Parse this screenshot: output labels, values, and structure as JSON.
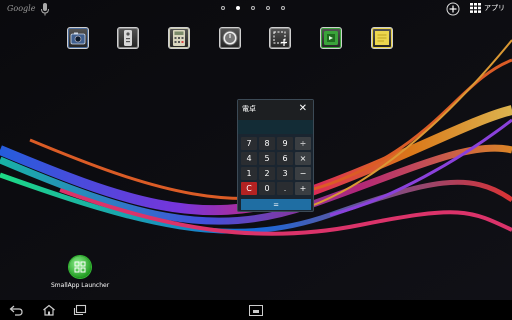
{
  "topbar": {
    "search_label": "Google",
    "pages": [
      false,
      true,
      false,
      false,
      false
    ],
    "apps_label": "アプリ"
  },
  "small_apps": [
    {
      "name": "camera",
      "color": "#4a6b9a"
    },
    {
      "name": "remote",
      "color": "#8a8a8a"
    },
    {
      "name": "calculator",
      "color": "#c9c9b0"
    },
    {
      "name": "timer",
      "color": "#7a7a7a"
    },
    {
      "name": "screen-capture",
      "color": "#8a8a8a"
    },
    {
      "name": "browser",
      "color": "#3aa33a"
    },
    {
      "name": "sticky-note",
      "color": "#e9d24a"
    }
  ],
  "calculator": {
    "title": "電卓",
    "keys": [
      "7",
      "8",
      "9",
      "÷",
      "4",
      "5",
      "6",
      "×",
      "1",
      "2",
      "3",
      "−",
      "C",
      "0",
      ".",
      "+"
    ],
    "equals": "="
  },
  "shortcut": {
    "label": "SmallApp Launcher"
  }
}
